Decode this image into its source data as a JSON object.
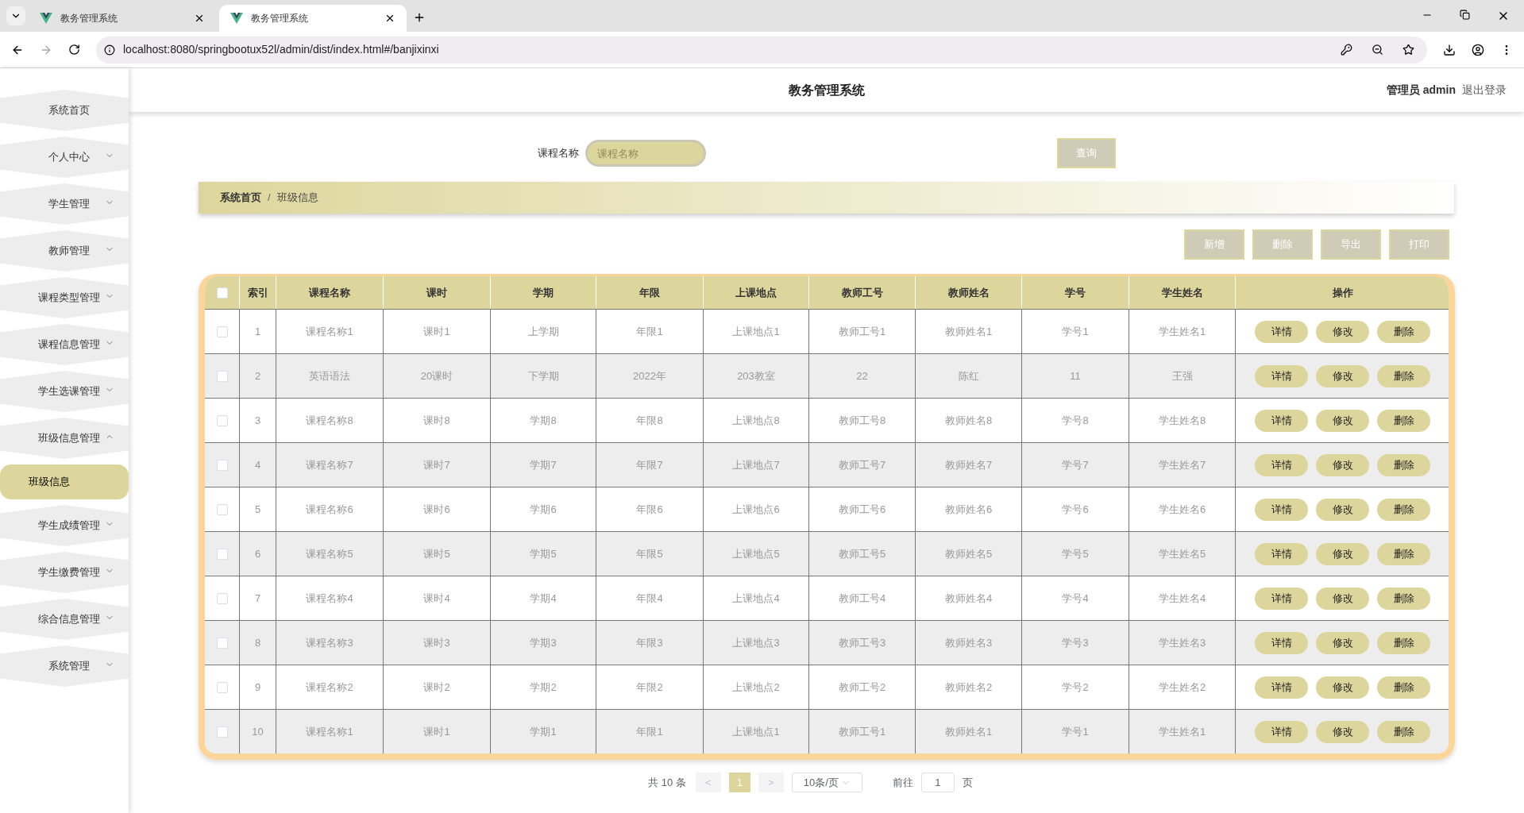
{
  "browser": {
    "tabs": [
      {
        "title": "教务管理系统",
        "selected": false
      },
      {
        "title": "教务管理系统",
        "selected": true
      }
    ],
    "url": "localhost:8080/springbootux52l/admin/dist/index.html#/banjixinxi"
  },
  "header": {
    "title": "教务管理系统",
    "role": "管理员",
    "user": "admin",
    "logout": "退出登录"
  },
  "sidebar": {
    "items": [
      {
        "label": "系统首页",
        "kind": "link"
      },
      {
        "label": "个人中心",
        "kind": "menu",
        "expanded": false
      },
      {
        "label": "学生管理",
        "kind": "menu",
        "expanded": false
      },
      {
        "label": "教师管理",
        "kind": "menu",
        "expanded": false
      },
      {
        "label": "课程类型管理",
        "kind": "menu",
        "expanded": false
      },
      {
        "label": "课程信息管理",
        "kind": "menu",
        "expanded": false
      },
      {
        "label": "学生选课管理",
        "kind": "menu",
        "expanded": false
      },
      {
        "label": "班级信息管理",
        "kind": "menu",
        "expanded": true,
        "children": [
          {
            "label": "班级信息",
            "selected": true
          }
        ]
      },
      {
        "label": "学生成绩管理",
        "kind": "menu",
        "expanded": false
      },
      {
        "label": "学生缴费管理",
        "kind": "menu",
        "expanded": false
      },
      {
        "label": "综合信息管理",
        "kind": "menu",
        "expanded": false
      },
      {
        "label": "系统管理",
        "kind": "menu",
        "expanded": false
      }
    ]
  },
  "search": {
    "label": "课程名称",
    "placeholder": "课程名称",
    "button": "查询"
  },
  "breadcrumb": [
    "系统首页",
    "/",
    "班级信息"
  ],
  "toolbar": [
    "新增",
    "删除",
    "导出",
    "打印"
  ],
  "table": {
    "select_all_checked": false,
    "columns": [
      "索引",
      "课程名称",
      "课时",
      "学期",
      "年限",
      "上课地点",
      "教师工号",
      "教师姓名",
      "学号",
      "学生姓名",
      "操作"
    ],
    "rows": [
      {
        "checked": false,
        "cells": [
          "1",
          "课程名称1",
          "课时1",
          "上学期",
          "年限1",
          "上课地点1",
          "教师工号1",
          "教师姓名1",
          "学号1",
          "学生姓名1"
        ],
        "actions": [
          "详情",
          "修改",
          "删除"
        ]
      },
      {
        "checked": false,
        "cells": [
          "2",
          "英语语法",
          "20课时",
          "下学期",
          "2022年",
          "203教室",
          "22",
          "陈红",
          "11",
          "王强"
        ],
        "actions": [
          "详情",
          "修改",
          "删除"
        ]
      },
      {
        "checked": false,
        "cells": [
          "3",
          "课程名称8",
          "课时8",
          "学期8",
          "年限8",
          "上课地点8",
          "教师工号8",
          "教师姓名8",
          "学号8",
          "学生姓名8"
        ],
        "actions": [
          "详情",
          "修改",
          "删除"
        ]
      },
      {
        "checked": false,
        "cells": [
          "4",
          "课程名称7",
          "课时7",
          "学期7",
          "年限7",
          "上课地点7",
          "教师工号7",
          "教师姓名7",
          "学号7",
          "学生姓名7"
        ],
        "actions": [
          "详情",
          "修改",
          "删除"
        ]
      },
      {
        "checked": false,
        "cells": [
          "5",
          "课程名称6",
          "课时6",
          "学期6",
          "年限6",
          "上课地点6",
          "教师工号6",
          "教师姓名6",
          "学号6",
          "学生姓名6"
        ],
        "actions": [
          "详情",
          "修改",
          "删除"
        ]
      },
      {
        "checked": false,
        "cells": [
          "6",
          "课程名称5",
          "课时5",
          "学期5",
          "年限5",
          "上课地点5",
          "教师工号5",
          "教师姓名5",
          "学号5",
          "学生姓名5"
        ],
        "actions": [
          "详情",
          "修改",
          "删除"
        ]
      },
      {
        "checked": false,
        "cells": [
          "7",
          "课程名称4",
          "课时4",
          "学期4",
          "年限4",
          "上课地点4",
          "教师工号4",
          "教师姓名4",
          "学号4",
          "学生姓名4"
        ],
        "actions": [
          "详情",
          "修改",
          "删除"
        ]
      },
      {
        "checked": false,
        "cells": [
          "8",
          "课程名称3",
          "课时3",
          "学期3",
          "年限3",
          "上课地点3",
          "教师工号3",
          "教师姓名3",
          "学号3",
          "学生姓名3"
        ],
        "actions": [
          "详情",
          "修改",
          "删除"
        ]
      },
      {
        "checked": false,
        "cells": [
          "9",
          "课程名称2",
          "课时2",
          "学期2",
          "年限2",
          "上课地点2",
          "教师工号2",
          "教师姓名2",
          "学号2",
          "学生姓名2"
        ],
        "actions": [
          "详情",
          "修改",
          "删除"
        ]
      },
      {
        "checked": false,
        "cells": [
          "10",
          "课程名称1",
          "课时1",
          "学期1",
          "年限1",
          "上课地点1",
          "教师工号1",
          "教师姓名1",
          "学号1",
          "学生姓名1"
        ],
        "actions": [
          "详情",
          "修改",
          "删除"
        ]
      }
    ]
  },
  "pagination": {
    "total": "共 10 条",
    "prev": "<",
    "pages": [
      {
        "label": "1",
        "selected": true
      }
    ],
    "next": ">",
    "page_size": "10条/页",
    "goto_label": "前往",
    "goto_value": "1",
    "goto_suffix": "页"
  }
}
